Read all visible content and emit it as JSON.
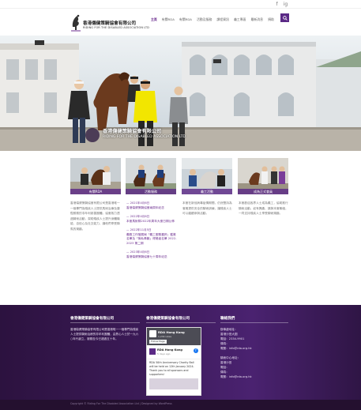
{
  "topbar": {
    "social": [
      "f",
      "ig"
    ]
  },
  "brand": {
    "name_cn": "香港傷健策騎協會有限公司",
    "name_en": "RIDING FOR THE DISABLED ASSOCIATION LTD"
  },
  "nav": {
    "items": [
      "主頁",
      "有關RDA",
      "有關RDA",
      "活動及服務",
      "課程資訊",
      "義工專區",
      "最新消息",
      "捐助"
    ],
    "active_index": 0
  },
  "hero": {
    "watermark_cn": "香港傷健策騎協會有限公司",
    "watermark_en": "RIDING FOR THE DISABLED ASSOCIATION LTD"
  },
  "cards": [
    {
      "label": "有關RDA"
    },
    {
      "label": "活動服務"
    },
    {
      "label": "義工活動"
    },
    {
      "label": "成為正式會員"
    }
  ],
  "intro": {
    "text": "香港傷健策騎協會有限公司是香港唯一一個專門為殘疾人士提供馬術治療及康復服務的非牟利慈善團體。協會致力透過騎術活動，幫助殘疾人士提升身體機能、自信心及社交能力，讓他們享受騎馬的樂趣。"
  },
  "news": [
    {
      "date": "— 2021年4月6日",
      "title": "香港傷健策騎協會兩周年紀念"
    },
    {
      "date": "— 2022年4月6日",
      "title": "本會馬術隊2022年周年大會日期公佈"
    },
    {
      "date": "— 2022年11月5日",
      "title": "義務工作發展局「義工服務嘉許」獲獎名單及「無私奉獻」得獎者名單 2022-2023 第二期"
    },
    {
      "date": "— 2023年4月6日",
      "title": "香港傷健策騎協會七十周年紀念"
    }
  ],
  "col3": {
    "text": "本會在新冠病毒疫情期間，仍然堅持為會員提供安全的騎術訓練，讓殘疾人士可以繼續參與活動。"
  },
  "col4": {
    "text": "本會歡迎各界人士成為義工，協助推行騎術活動。如有興趣，請與本會聯絡，一同支持殘疾人士享受騎術樂趣。"
  },
  "footer": {
    "col1_title": "香港傷健策騎協會有限公司",
    "col1_text": "香港傷健策騎協會有限公司是香港唯一一個專門為殘疾人士提供騎術治療的非牟利團體，由熱心人士於一九六○年代創立，服務至今已超過五十年。",
    "col2_title": "香港傷健策騎協會有限公司",
    "col3_title": "聯絡我們",
    "contact_lines": [
      "辦事處地址：",
      "香港沙田大圍",
      "電話：2334-9901",
      "傳真：",
      "電郵：info@rda.org.hk",
      "",
      "騎術中心地址：",
      "香港沙田",
      "電話：",
      "傳真：",
      "電郵：info@rda.org.hk"
    ]
  },
  "facebook": {
    "page_name": "RDA Hong Kong",
    "likes": "1,234 Likes",
    "follow_label": "Follow Page",
    "post_name": "RDA Hong Kong",
    "post_time": "5 days ago",
    "post_text": "RDA 50th Anniversary Charity Ball will be held on 12th January 2024. Thank you to all sponsors and supporters!"
  },
  "copyright": {
    "text": "Copyright © Riding For The Disabled Association Ltd | Designed by WordPress"
  },
  "colors": {
    "brand_purple": "#5b2a86",
    "footer_dark": "#2c123f"
  }
}
